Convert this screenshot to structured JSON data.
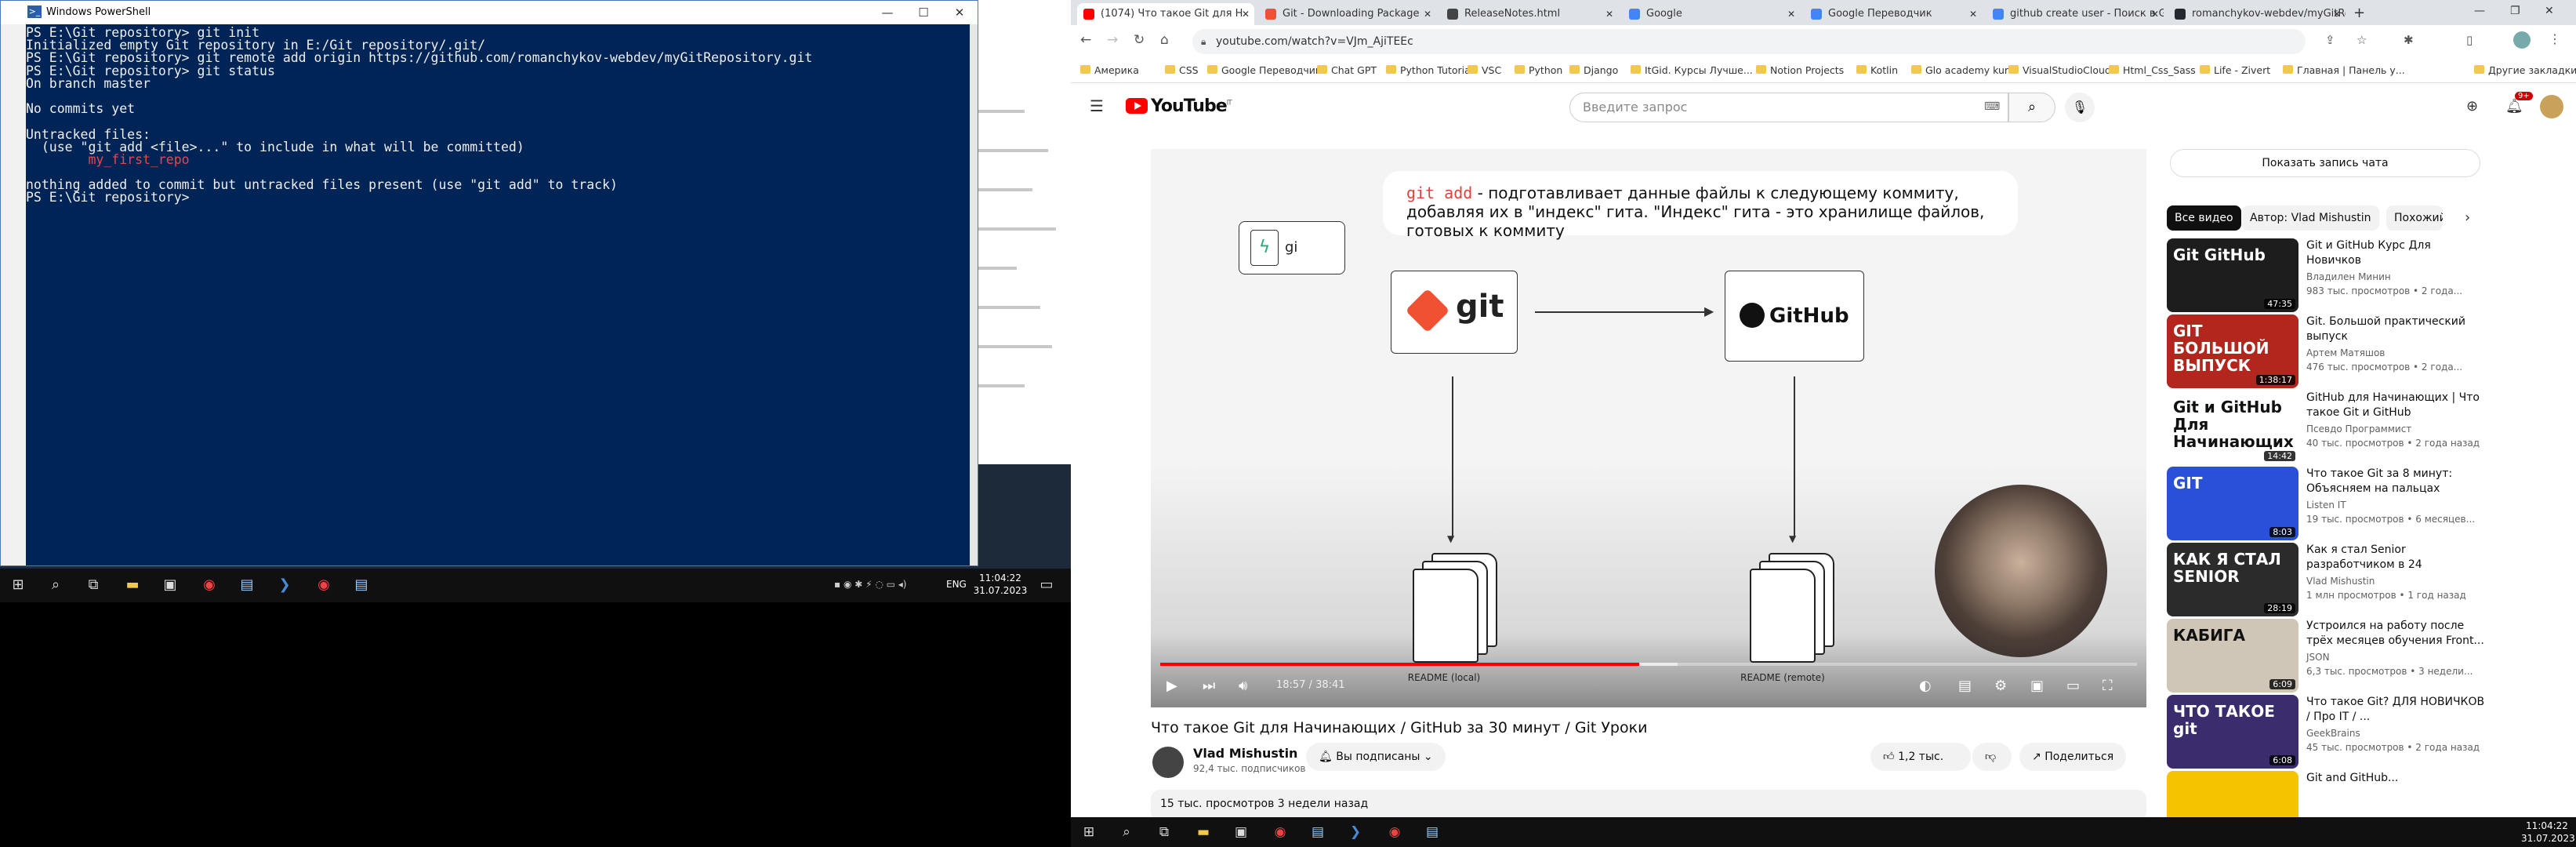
{
  "left": {
    "powershell": {
      "title": "Windows PowerShell",
      "terminal_lines": [
        "PS E:\\Git repository> git init",
        "Initialized empty Git repository in E:/Git repository/.git/",
        "PS E:\\Git repository> git remote add origin https://github.com/romanchykov-webdev/myGitRepository.git",
        "PS E:\\Git repository> git status",
        "On branch master",
        "",
        "No commits yet",
        "",
        "Untracked files:",
        "  (use \"git add <file>...\" to include in what will be committed)",
        "        my_first_repo",
        "",
        "nothing added to commit but untracked files present (use \"git add\" to track)",
        "PS E:\\Git repository>"
      ],
      "untracked_color": "#e5484d",
      "background": "#012456"
    },
    "taskbar": {
      "time": "11:04:22",
      "date": "31.07.2023",
      "lang": "ENG"
    }
  },
  "right": {
    "tabs": [
      {
        "label": "(1074) Что такое Git для Н",
        "color": "#ff0000"
      },
      {
        "label": "Git - Downloading Package",
        "color": "#f05133"
      },
      {
        "label": "ReleaseNotes.html",
        "color": "#444444"
      },
      {
        "label": "Google",
        "color": "#4285f4"
      },
      {
        "label": "Google Переводчик",
        "color": "#4285f4"
      },
      {
        "label": "github create user - Поиск в G",
        "color": "#4285f4"
      },
      {
        "label": "romanchykov-webdev/myGitRe",
        "color": "#24292f"
      }
    ],
    "url": "youtube.com/watch?v=VJm_AjiTEEc",
    "bookmarks": [
      "Америка",
      "CSS",
      "Google Переводчик",
      "Chat GPT",
      "Python Tutorial",
      "VSC",
      "Python",
      "Django",
      "ItGid. Курсы Лучше...",
      "Notion Projects",
      "Kotlin",
      "Glo academy kurs",
      "VisualStudioCloud",
      "Html_Css_Sass",
      "Life - Zivert",
      "Главная | Панель у...",
      "Другие закладки"
    ],
    "youtube": {
      "logo": "YouTube",
      "logo_country": "IT",
      "search_placeholder": "Введите запрос",
      "notifications": "9+",
      "slide": {
        "code": "git add",
        "text": " - подготавливает данные файлы к следующему коммиту, добавляя их в \"индекс\" гита. \"Индекс\" гита - это хранилище файлов, готовых к коммиту",
        "git_label": "git",
        "github_label": "GitHub",
        "mini_label": "gi",
        "readme_local": "README (local)",
        "readme_remote": "README (remote)"
      },
      "player": {
        "time": "18:57 / 38:41",
        "progress": 0.49,
        "buffered": 0.53
      },
      "video_title": "Что такое Git для Начинающих / GitHub за 30 минут / Git Уроки",
      "channel": "Vlad Mishustin",
      "subscribers": "92,4 тыс. подписчиков",
      "subscribed_label": "Вы подписаны",
      "likes": "1,2 тыс.",
      "share_label": "Поделиться",
      "description_meta": "15 тыс. просмотров  3 недели назад",
      "chat_button": "Показать запись чата",
      "chips": [
        "Все видео",
        "Автор: Vlad Mishustin",
        "Похожий"
      ],
      "recommendations": [
        {
          "title": "Git и GitHub Курс Для Новичков",
          "channel": "Владилен Минин",
          "views": "983 тыс. просмотров • 2 года...",
          "duration": "47:35",
          "thumb": "#1d1d1d",
          "thumb_text": "Git GitHub"
        },
        {
          "title": "Git. Большой практический выпуск",
          "channel": "Артем Матяшов",
          "views": "476 тыс. просмотров • 2 года...",
          "duration": "1:38:17",
          "thumb": "#b3261e",
          "thumb_text": "GIT БОЛЬШОЙ ВЫПУСК"
        },
        {
          "title": "GitHub для Начинающих | Что такое Git и GitHub",
          "channel": "Псевдо Программист",
          "views": "40 тыс. просмотров • 2 года назад",
          "duration": "14:42",
          "thumb": "#ffffff",
          "thumb_text": "Git и GitHub Для Начинающих"
        },
        {
          "title": "Что такое Git за 8 минут: Объясняем на пальцах",
          "channel": "Listen IT",
          "views": "19 тыс. просмотров • 6 месяцев...",
          "duration": "8:03",
          "thumb": "#2a4fd8",
          "thumb_text": "GIT"
        },
        {
          "title": "Как я стал Senior разработчиком в 24",
          "channel": "Vlad Mishustin",
          "views": "1 млн просмотров • 1 год назад",
          "duration": "28:19",
          "thumb": "#2b2b2b",
          "thumb_text": "КАК Я СТАЛ SENIOR"
        },
        {
          "title": "Устроился на работу после трёх месяцев обучения Front...",
          "channel": "JSON",
          "views": "6,3 тыс. просмотров • 3 недели...",
          "duration": "6:09",
          "thumb": "#cfc6b8",
          "thumb_text": "КАБИГА"
        },
        {
          "title": "Что такое Git? ДЛЯ НОВИЧКОВ / Про IT / ...",
          "channel": "GeekBrains",
          "views": "45 тыс. просмотров • 2 года назад",
          "duration": "6:08",
          "thumb": "#3b2c6e",
          "thumb_text": "ЧТО ТАКОЕ git"
        },
        {
          "title": "Git and GitHub...",
          "channel": "",
          "views": "",
          "duration": "",
          "thumb": "#f5c400",
          "thumb_text": ""
        }
      ]
    },
    "taskbar": {
      "time": "11:04:22",
      "date": "31.07.2023"
    }
  }
}
